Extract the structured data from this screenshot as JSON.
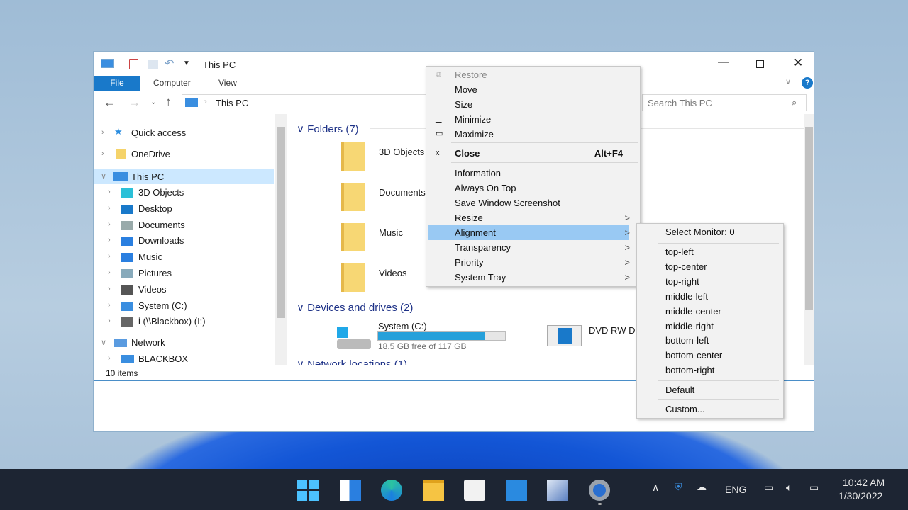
{
  "window": {
    "title": "This PC",
    "tabs": [
      "File",
      "Computer",
      "View"
    ],
    "address": "This PC",
    "search_placeholder": "Search This PC",
    "status": "10 items"
  },
  "nav": {
    "top": [
      {
        "label": "Quick access"
      },
      {
        "label": "OneDrive"
      },
      {
        "label": "This PC"
      }
    ],
    "children": [
      "3D Objects",
      "Desktop",
      "Documents",
      "Downloads",
      "Music",
      "Pictures",
      "Videos",
      "System (C:)",
      "i (\\\\Blackbox) (I:)"
    ],
    "network": "Network",
    "network_children": [
      "BLACKBOX"
    ]
  },
  "content": {
    "folders_header": "Folders (7)",
    "folders": [
      "3D Objects",
      "Documents",
      "Music",
      "Videos"
    ],
    "devices_header": "Devices and drives (2)",
    "drive": {
      "name": "System (C:)",
      "free_text": "18.5 GB free of 117 GB",
      "used_fraction": 0.84
    },
    "dvd": "DVD RW Dr",
    "network_header": "Network locations (1)"
  },
  "menu": {
    "items": [
      {
        "label": "Restore",
        "icon": "restore-icon",
        "disabled": true
      },
      {
        "label": "Move"
      },
      {
        "label": "Size"
      },
      {
        "label": "Minimize",
        "icon": "minimize-icon"
      },
      {
        "label": "Maximize",
        "icon": "maximize-icon"
      },
      {
        "label": "Close",
        "icon": "close-icon",
        "shortcut": "Alt+F4",
        "bold": true
      },
      {
        "label": "Information"
      },
      {
        "label": "Always On Top"
      },
      {
        "label": "Save Window Screenshot"
      },
      {
        "label": "Resize",
        "submenu": true
      },
      {
        "label": "Alignment",
        "submenu": true,
        "highlighted": true
      },
      {
        "label": "Transparency",
        "submenu": true
      },
      {
        "label": "Priority",
        "submenu": true
      },
      {
        "label": "System Tray",
        "submenu": true
      }
    ],
    "arrow": ">",
    "restore_glyph": "⧉",
    "min_glyph": "▁",
    "max_glyph": "▭",
    "close_glyph": "x"
  },
  "submenu": {
    "header": "Select Monitor: 0",
    "items": [
      "top-left",
      "top-center",
      "top-right",
      "middle-left",
      "middle-center",
      "middle-right",
      "bottom-left",
      "bottom-center",
      "bottom-right"
    ],
    "default": "Default",
    "custom": "Custom..."
  },
  "tray": {
    "lang": "ENG",
    "time": "10:42 AM",
    "date": "1/30/2022"
  },
  "colors": {
    "accent": "#1979ca",
    "highlight": "#99c9f3",
    "selected": "#cce8ff",
    "taskbar": "#1d2533"
  }
}
